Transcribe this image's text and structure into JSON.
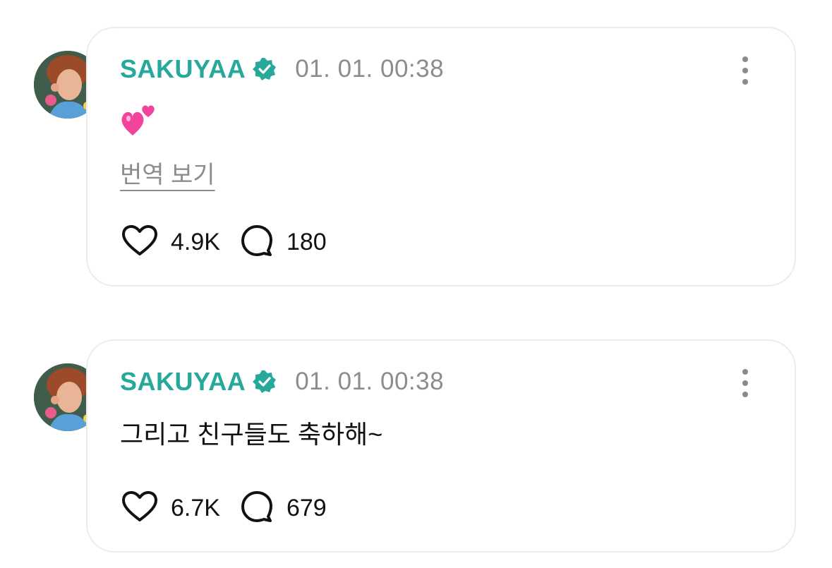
{
  "posts": [
    {
      "username": "SAKUYAA",
      "timestamp": "01. 01. 00:38",
      "text": "",
      "emoji": "two-hearts",
      "translate_label": "번역 보기",
      "likes": "4.9K",
      "comments": "180"
    },
    {
      "username": "SAKUYAA",
      "timestamp": "01. 01. 00:38",
      "text": "그리고 친구들도 축하해~",
      "likes": "6.7K",
      "comments": "679"
    }
  ],
  "colors": {
    "username": "#26a89b",
    "verified": "#26a89b",
    "timestamp": "#8c8c8c",
    "card_border": "#ececef"
  },
  "icons": {
    "verified": "verified-badge-icon",
    "more": "more-vertical-icon",
    "like": "heart-outline-icon",
    "comment": "speech-bubble-icon"
  }
}
